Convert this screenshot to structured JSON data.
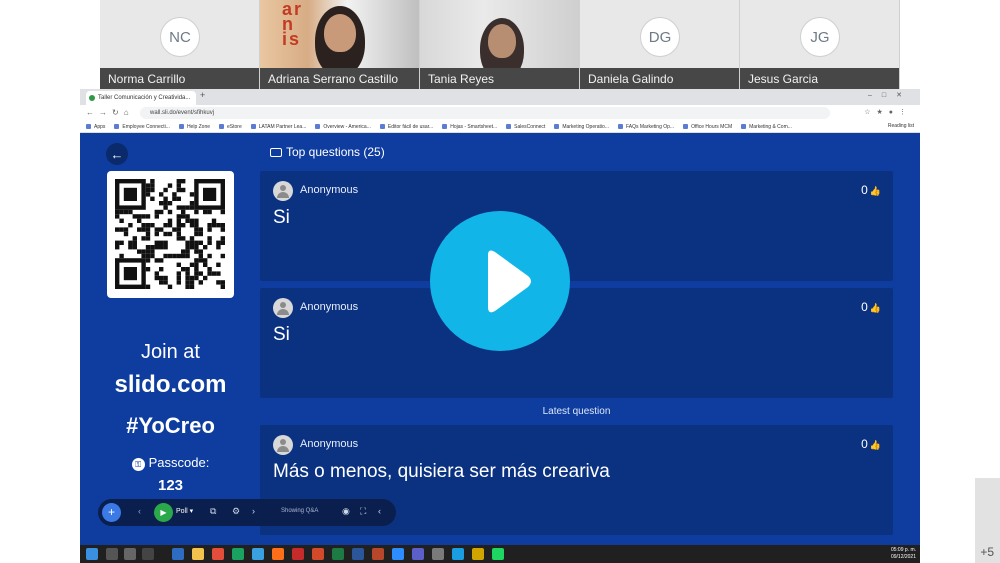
{
  "participants": [
    {
      "name": "Norma Carrillo",
      "initials": "NC"
    },
    {
      "name": "Adriana Serrano Castillo"
    },
    {
      "name": "Tania Reyes"
    },
    {
      "name": "Daniela Galindo",
      "initials": "DG"
    },
    {
      "name": "Jesus Garcia",
      "initials": "JG"
    }
  ],
  "more_participants": "+5",
  "browser": {
    "tab_title": "Taller Comunicación y Creativida...",
    "url": "wall.sli.do/event/sfihkuvj",
    "bookmarks": [
      "Apps",
      "Employee Connecti...",
      "Help Zone",
      "eStore",
      "LATAM Partner Lea...",
      "Overview - America...",
      "Editor fácil de usar...",
      "Hojas - Smartsheet...",
      "SalesConnect",
      "Marketing Operatio...",
      "FAQs Marketing Op...",
      "Office Hours MCM",
      "Marketing & Com..."
    ],
    "reading_list": "Reading list"
  },
  "slido": {
    "join_label": "Join at",
    "join_url": "slido.com",
    "hashtag": "#YoCreo",
    "passcode_label": "Passcode:",
    "passcode": "123",
    "section_title": "Top questions (25)",
    "latest_label": "Latest question",
    "questions": [
      {
        "author": "Anonymous",
        "votes": "0",
        "text": "Si"
      },
      {
        "author": "Anonymous",
        "votes": "0",
        "text": "Si"
      },
      {
        "author": "Anonymous",
        "votes": "0",
        "text": "Más o menos, quisiera ser más creariva"
      }
    ],
    "presenter_bar": {
      "mode": "Poll",
      "status": "Showing Q&A"
    }
  },
  "taskbar": {
    "time": "05:09 p. m.",
    "date": "09/12/2021"
  },
  "colors": {
    "slido_bg": "#0e3d9f",
    "card_bg": "#0b3281",
    "play_button": "#12b5e8",
    "taskbar": "#202020"
  },
  "icons": {
    "back": "arrow-left-icon",
    "play": "play-icon",
    "questions": "speech-bubble-icon",
    "likes": "thumbs-up-icon"
  }
}
